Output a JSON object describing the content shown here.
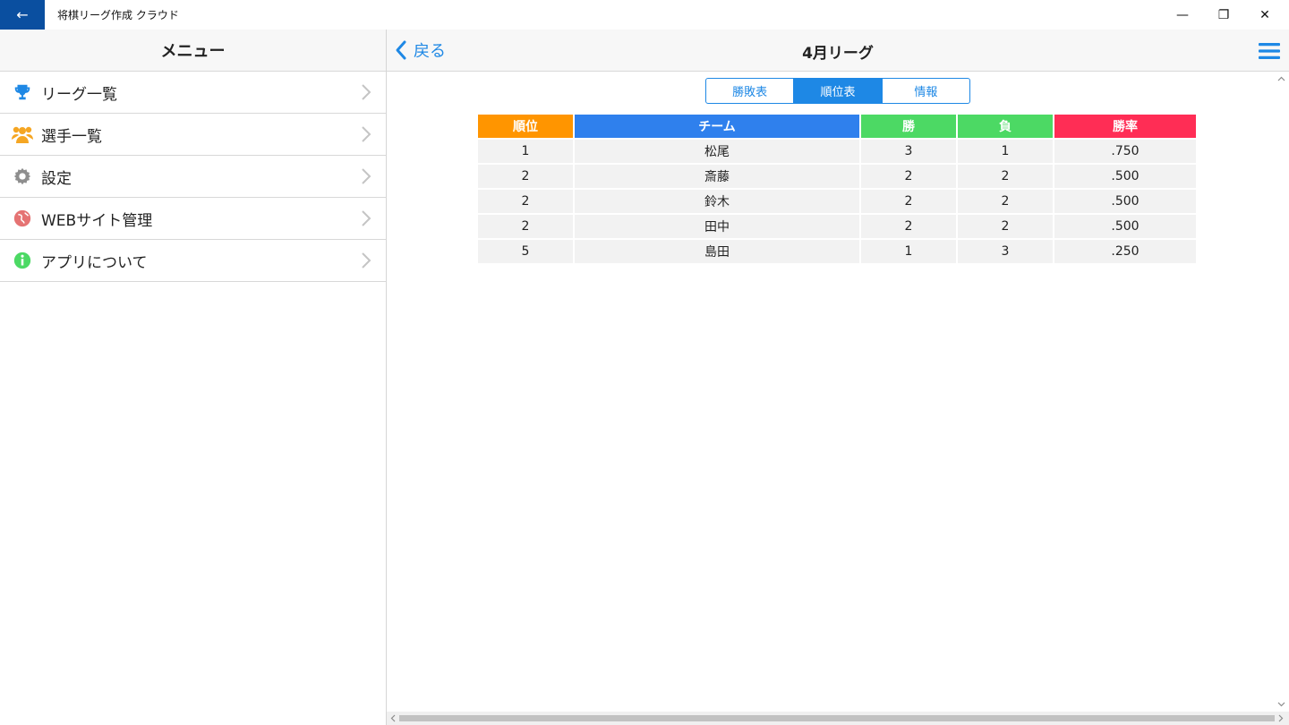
{
  "window": {
    "title": "将棋リーグ作成 クラウド",
    "back_icon": "←",
    "minimize": "—",
    "restore": "❐",
    "close": "✕"
  },
  "sidebar": {
    "header": "メニュー",
    "items": [
      {
        "label": "リーグ一覧",
        "icon": "trophy-icon"
      },
      {
        "label": "選手一覧",
        "icon": "people-icon"
      },
      {
        "label": "設定",
        "icon": "gear-icon"
      },
      {
        "label": "WEBサイト管理",
        "icon": "globe-icon"
      },
      {
        "label": "アプリについて",
        "icon": "info-icon"
      }
    ]
  },
  "nav": {
    "back_label": "戻る",
    "title": "4月リーグ"
  },
  "tabs": [
    {
      "label": "勝敗表",
      "active": false
    },
    {
      "label": "順位表",
      "active": true
    },
    {
      "label": "情報",
      "active": false
    }
  ],
  "standings": {
    "headers": [
      "順位",
      "チーム",
      "勝",
      "負",
      "勝率"
    ],
    "header_colors": [
      "#ff9500",
      "#2f80ed",
      "#4cd964",
      "#4cd964",
      "#ff2d55"
    ],
    "rows": [
      [
        "1",
        "松尾",
        "3",
        "1",
        ".750"
      ],
      [
        "2",
        "斎藤",
        "2",
        "2",
        ".500"
      ],
      [
        "2",
        "鈴木",
        "2",
        "2",
        ".500"
      ],
      [
        "2",
        "田中",
        "2",
        "2",
        ".500"
      ],
      [
        "5",
        "島田",
        "1",
        "3",
        ".250"
      ]
    ]
  }
}
